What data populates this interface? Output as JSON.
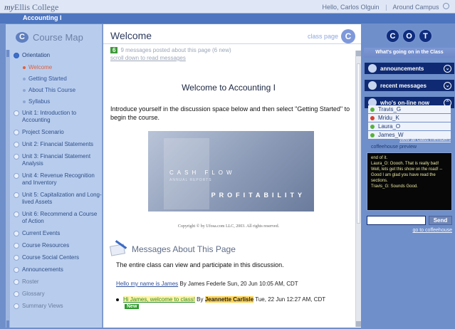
{
  "topbar": {
    "brand_prefix": "my",
    "brand_name": "Ellis College",
    "greeting": "Hello, Carlos Olguin",
    "separator": "|",
    "around_campus": "Around Campus"
  },
  "course_title": "Accounting I",
  "left_nav": {
    "title": "Course Map",
    "logo_glyph": "C",
    "items": [
      {
        "label": "Orientation",
        "active": true
      },
      {
        "label": "Welcome",
        "sub": true,
        "current": true
      },
      {
        "label": "Getting Started",
        "sub": true
      },
      {
        "label": "About This Course",
        "sub": true
      },
      {
        "label": "Syllabus",
        "sub": true
      },
      {
        "label": "Unit 1: Introduction to Accounting"
      },
      {
        "label": "Project Scenario"
      },
      {
        "label": "Unit 2: Financial Statements"
      },
      {
        "label": "Unit 3: Financial Statement Analysis"
      },
      {
        "label": "Unit 4: Revenue Recognition and Inventory"
      },
      {
        "label": "Unit 5: Capitalization and Long-lived Assets"
      },
      {
        "label": "Unit 6: Recommend a Course of Action"
      },
      {
        "label": "Current Events"
      },
      {
        "label": "Course Resources"
      },
      {
        "label": "Course Social Centers"
      },
      {
        "label": "Announcements"
      },
      {
        "label": "Roster",
        "dim": true
      },
      {
        "label": "Glossary",
        "dim": true
      },
      {
        "label": "Summary Views",
        "dim": true
      }
    ]
  },
  "main": {
    "title": "Welcome",
    "class_page_label": "class page",
    "class_page_glyph": "C",
    "message_count": "6",
    "message_text": "9 messages posted about this page (6 new)",
    "scroll_link": "scroll down to read messages",
    "heading": "Welcome to Accounting I",
    "intro": "Introduce yourself in the discussion space below and then select \"Getting Started\" to begin the course.",
    "hero": {
      "line1": "CASH FLOW",
      "line2": "ANNUAL REPORTS",
      "line3": "PROFITABILITY"
    },
    "copyright": "Copyright © by Ufosa.com LLC, 2003. All rights reserved.",
    "messages_title": "Messages About This Page",
    "entire_class_text": "The entire class can view and participate in this discussion.",
    "post1": {
      "link": "Hello my name is James",
      "meta": " By James Federle Sun, 20 Jun 10:05 AM, CDT"
    },
    "post2": {
      "link": "Hi James, welcome to class!",
      "by": " By ",
      "author": "Jeannette Carlisle",
      "meta": " Tue, 22 Jun 12:27 AM, CDT",
      "badge": "New"
    }
  },
  "right_panel": {
    "cot_icons": [
      "C",
      "O",
      "T"
    ],
    "going_on": "What's going on in the Class",
    "sections": [
      {
        "label": "announcements",
        "chevron": "⌄"
      },
      {
        "label": "recent messages",
        "chevron": "⌄"
      },
      {
        "label": "who's on-line now",
        "chevron": "⌃"
      }
    ],
    "online": [
      {
        "name": "Travis_G",
        "status_color": "#57b13a"
      },
      {
        "name": "Mridu_K",
        "status_color": "#d6402f"
      },
      {
        "name": "Laura_O",
        "status_color": "#57b13a"
      },
      {
        "name": "James_W",
        "status_color": "#57b13a"
      }
    ],
    "view_all": "view all class members",
    "coffeehouse_label": "coffeehouse preview",
    "chat_text": "end of it.\nLaura_O: Ooooh.  That is really bad!  Well, lets get this show on the road! -- Good I am glad you have read the sections.\nTravis_G: Sounds Good.",
    "send_label": "Send",
    "goto_coffeehouse": "go to coffeehouse"
  }
}
